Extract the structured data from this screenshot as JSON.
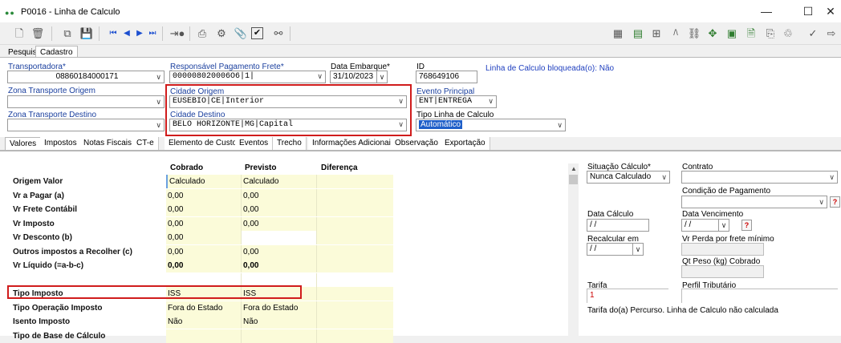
{
  "window": {
    "title": "P0016 - Linha de Calculo",
    "minimize": "—",
    "maximize": "☐",
    "close": "✕"
  },
  "main_tabs": [
    "Pesquisa",
    "Cadastro"
  ],
  "form": {
    "transportadora": {
      "label": "Transportadora*",
      "value": "08860184000171"
    },
    "responsavel": {
      "label": "Responsável Pagamento Frete*",
      "value": "000008020006O6|1|"
    },
    "data_embarque": {
      "label": "Data Embarque*",
      "value": "31/10/2023"
    },
    "id": {
      "label": "ID",
      "value": "768649106"
    },
    "bloqueada": "Linha de Calculo bloqueada(o): Não",
    "zona_origem": {
      "label": "Zona Transporte Origem",
      "value": ""
    },
    "cidade_origem": {
      "label": "Cidade Origem",
      "value": "EUSEBIO|CE|Interior"
    },
    "evento_principal": {
      "label": "Evento Principal",
      "value": "ENT|ENTREGA"
    },
    "zona_destino": {
      "label": "Zona Transporte Destino",
      "value": ""
    },
    "cidade_destino": {
      "label": "Cidade Destino",
      "value": "BELO HORIZONTE|MG|Capital"
    },
    "tipo_linha": {
      "label": "Tipo Linha de Calculo",
      "value": "Automático"
    }
  },
  "sub_tabs": [
    "Valores",
    "Impostos",
    "Notas Fiscais",
    "CT-e",
    "Elemento de Custo",
    "Eventos",
    "Trecho",
    "Informações Adicionais",
    "Observação",
    "Exportação"
  ],
  "grid": {
    "headers": [
      "Cobrado",
      "Previsto",
      "Diferença"
    ],
    "rows": [
      {
        "label": "Origem Valor",
        "cobrado": "Calculado",
        "previsto": "Calculado",
        "diferenca": ""
      },
      {
        "label": "Vr a Pagar (a)",
        "cobrado": "0,00",
        "previsto": "0,00",
        "diferenca": ""
      },
      {
        "label": "Vr Frete Contábil",
        "cobrado": "0,00",
        "previsto": "0,00",
        "diferenca": ""
      },
      {
        "label": "Vr Imposto",
        "cobrado": "0,00",
        "previsto": "0,00",
        "diferenca": ""
      },
      {
        "label": "Vr Desconto (b)",
        "cobrado": "0,00",
        "previsto": "",
        "diferenca": ""
      },
      {
        "label": "Outros impostos a Recolher (c)",
        "cobrado": "0,00",
        "previsto": "0,00",
        "diferenca": ""
      },
      {
        "label": "Vr Líquido (=a-b-c)",
        "cobrado": "0,00",
        "previsto": "0,00",
        "diferenca": ""
      },
      {
        "label": "",
        "cobrado": "",
        "previsto": "",
        "diferenca": ""
      },
      {
        "label": "Tipo Imposto",
        "cobrado": "ISS",
        "previsto": "ISS",
        "diferenca": ""
      },
      {
        "label": "Tipo Operação Imposto",
        "cobrado": "Fora do Estado",
        "previsto": "Fora do Estado",
        "diferenca": ""
      },
      {
        "label": "Isento Imposto",
        "cobrado": "Não",
        "previsto": "Não",
        "diferenca": ""
      },
      {
        "label": "Tipo de Base de Cálculo",
        "cobrado": "",
        "previsto": "",
        "diferenca": ""
      }
    ]
  },
  "right": {
    "situacao": {
      "label": "Situação Cálculo*",
      "value": "Nunca Calculado"
    },
    "contrato": {
      "label": "Contrato",
      "value": ""
    },
    "condicao": {
      "label": "Condição de Pagamento",
      "value": ""
    },
    "data_calculo": {
      "label": "Data Cálculo",
      "value": " / /"
    },
    "data_vencimento": {
      "label": "Data Vencimento",
      "value": " / /"
    },
    "recalcular": {
      "label": "Recalcular em",
      "value": " / /"
    },
    "vr_perda": {
      "label": "Vr Perda por frete mínimo",
      "value": ""
    },
    "qt_peso": {
      "label": "Qt Peso (kg) Cobrado",
      "value": ""
    },
    "tarifa": {
      "label": "Tarifa",
      "value": "1"
    },
    "perfil": {
      "label": "Perfil Tributário",
      "value": ""
    },
    "tarifa_msg": "Tarifa do(a) Percurso. Linha de Calculo não calculada",
    "help": "?"
  },
  "colors": {
    "label_blue": "#1a3f9e",
    "highlight_red": "#d01c1c",
    "cell_yellow": "#fbfbd9",
    "select_blue": "#1f5fc9"
  }
}
